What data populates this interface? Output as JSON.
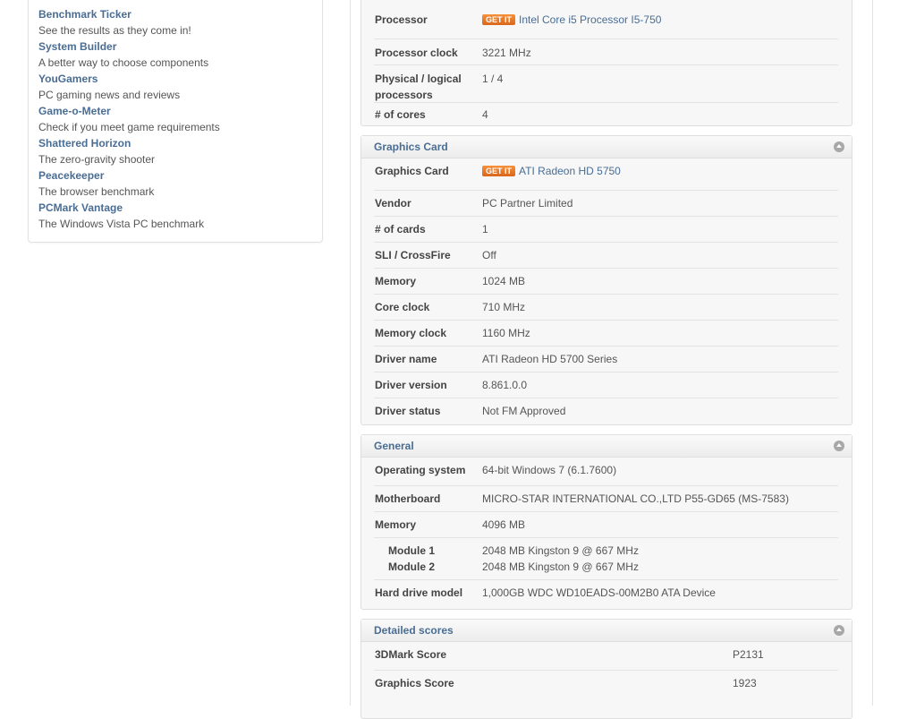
{
  "sidebar": {
    "items": [
      {
        "title": "Benchmark Ticker",
        "desc": "See the results as they come in!"
      },
      {
        "title": "System Builder",
        "desc": "A better way to choose components"
      },
      {
        "title": "YouGamers",
        "desc": "PC gaming news and reviews"
      },
      {
        "title": "Game-o-Meter",
        "desc": "Check if you meet game requirements"
      },
      {
        "title": "Shattered Horizon",
        "desc": "The zero-gravity shooter"
      },
      {
        "title": "Peacekeeper",
        "desc": "The browser benchmark"
      },
      {
        "title": "PCMark Vantage",
        "desc": "The Windows Vista PC benchmark"
      }
    ]
  },
  "getit_label": "GET IT",
  "cpu": {
    "rows": [
      {
        "label": "Processor",
        "value": "Intel Core i5 Processor I5-750"
      },
      {
        "label": "Processor clock",
        "value": "3221 MHz"
      },
      {
        "label": "Physical / logical",
        "label2": "processors",
        "value": "1 / 4"
      },
      {
        "label": "# of cores",
        "value": "4"
      }
    ]
  },
  "graphics": {
    "title": "Graphics Card",
    "rows": [
      {
        "label": "Graphics Card",
        "value": "ATI Radeon HD 5750"
      },
      {
        "label": "Vendor",
        "value": "PC Partner Limited"
      },
      {
        "label": "# of cards",
        "value": "1"
      },
      {
        "label": "SLI / CrossFire",
        "value": "Off"
      },
      {
        "label": "Memory",
        "value": "1024 MB"
      },
      {
        "label": "Core clock",
        "value": "710 MHz"
      },
      {
        "label": "Memory clock",
        "value": "1160 MHz"
      },
      {
        "label": "Driver name",
        "value": "ATI Radeon HD 5700 Series"
      },
      {
        "label": "Driver version",
        "value": "8.861.0.0"
      },
      {
        "label": "Driver status",
        "value": "Not FM Approved"
      }
    ]
  },
  "general": {
    "title": "General",
    "rows": [
      {
        "label": "Operating system",
        "value": "64-bit Windows 7 (6.1.7600)"
      },
      {
        "label": "Motherboard",
        "value": "MICRO-STAR INTERNATIONAL CO.,LTD P55-GD65 (MS-7583)"
      },
      {
        "label": "Memory",
        "value": "4096 MB"
      },
      {
        "label": "Module 1",
        "value": "2048 MB Kingston 9 @ 667 MHz"
      },
      {
        "label": "Module 2",
        "value": "2048 MB Kingston 9 @ 667 MHz"
      },
      {
        "label": "Hard drive model",
        "value": "1,000GB WDC WD10EADS-00M2B0 ATA Device"
      }
    ]
  },
  "scores": {
    "title": "Detailed scores",
    "rows": [
      {
        "label": "3DMark Score",
        "value": "P2131"
      },
      {
        "label": "Graphics Score",
        "value": "1923"
      }
    ]
  }
}
